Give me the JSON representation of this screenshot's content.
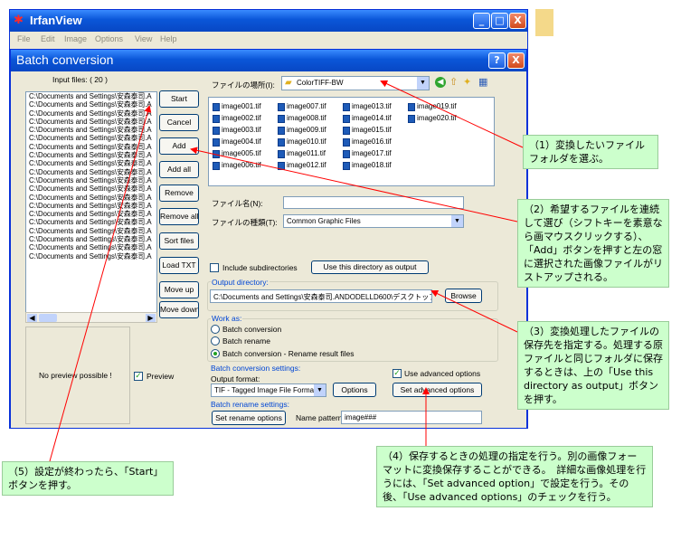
{
  "app": {
    "title": "IrfanView",
    "menu": [
      "File",
      "Edit",
      "Image",
      "Options",
      "View",
      "Help"
    ],
    "window_buttons": {
      "minimize": "_",
      "maximize": "□",
      "close": "X"
    }
  },
  "dialog": {
    "title": "Batch conversion",
    "help_button": "?",
    "close_button": "X",
    "input_files_label": "Input files:  ( 20 )",
    "input_files": [
      "C:\\Documents and Settings\\安森泰司.A",
      "C:\\Documents and Settings\\安森泰司.A",
      "C:\\Documents and Settings\\安森泰司.A",
      "C:\\Documents and Settings\\安森泰司.A",
      "C:\\Documents and Settings\\安森泰司.A",
      "C:\\Documents and Settings\\安森泰司.A",
      "C:\\Documents and Settings\\安森泰司.A",
      "C:\\Documents and Settings\\安森泰司.A",
      "C:\\Documents and Settings\\安森泰司.A",
      "C:\\Documents and Settings\\安森泰司.A",
      "C:\\Documents and Settings\\安森泰司.A",
      "C:\\Documents and Settings\\安森泰司.A",
      "C:\\Documents and Settings\\安森泰司.A",
      "C:\\Documents and Settings\\安森泰司.A",
      "C:\\Documents and Settings\\安森泰司.A",
      "C:\\Documents and Settings\\安森泰司.A",
      "C:\\Documents and Settings\\安森泰司.A",
      "C:\\Documents and Settings\\安森泰司.A",
      "C:\\Documents and Settings\\安森泰司.A",
      "C:\\Documents and Settings\\安森泰司.A"
    ],
    "buttons": {
      "start": "Start",
      "cancel": "Cancel",
      "add": "Add",
      "add_all": "Add all",
      "remove": "Remove",
      "remove_all": "Remove all",
      "sort_files": "Sort files",
      "load_txt": "Load TXT",
      "move_up": "Move up",
      "move_down": "Move down"
    },
    "preview_text": "No preview possible !",
    "preview_checkbox": "Preview",
    "look_in_label": "ファイルの場所(I):",
    "look_in_value": "ColorTIFF-BW",
    "files": [
      "image001.tif",
      "image002.tif",
      "image003.tif",
      "image004.tif",
      "image005.tif",
      "image006.tif",
      "image007.tif",
      "image008.tif",
      "image009.tif",
      "image010.tif",
      "image011.tif",
      "image012.tif",
      "image013.tif",
      "image014.tif",
      "image015.tif",
      "image016.tif",
      "image017.tif",
      "image018.tif",
      "image019.tif",
      "image020.tif"
    ],
    "filename_label": "ファイル名(N):",
    "filename_value": "",
    "filetype_label": "ファイルの種類(T):",
    "filetype_value": "Common Graphic Files",
    "include_subdirs": "Include subdirectories",
    "use_dir_button": "Use this directory as output",
    "output_dir_label": "Output directory:",
    "output_dir_value": "C:\\Documents and Settings\\安森泰司.ANDODELLD600\\デスクトップ\\E",
    "browse_button": "Browse",
    "work_as_label": "Work as:",
    "work_as_options": [
      "Batch conversion",
      "Batch rename",
      "Batch conversion - Rename result files"
    ],
    "work_as_selected": 2,
    "conversion_settings_label": "Batch conversion settings:",
    "output_format_label": "Output format:",
    "use_advanced_label": "Use advanced options",
    "output_format_value": "TIF - Tagged Image File Forma",
    "options_button": "Options",
    "set_advanced_button": "Set advanced options",
    "rename_settings_label": "Batch rename settings:",
    "set_rename_button": "Set rename options",
    "name_pattern_label": "Name pattern:",
    "name_pattern_value": "image###"
  },
  "callouts": {
    "c1": "（1）変換したいファイルフォルダを選ぶ。",
    "c2": "（2）希望するファイルを連続して選び（シフトキーを素意なら画マウスクリックする）、「Add」ボタンを押すと左の窓に選択された画像ファイルがリストアップされる。",
    "c3": "（3）変換処理したファイルの保存先を指定する。処理する原ファイルと同じフォルダに保存するときは、上の「Use this directory as output」ボタンを押す。",
    "c4": "（4）保存するときの処理の指定を行う。別の画像フォーマットに変換保存することができる。　詳細な画像処理を行うには、「Set advanced option」で設定を行う。その後、「Use advanced options」のチェックを行う。",
    "c5": "（5）設定が終わったら、「Start」ボタンを押す。"
  },
  "colors": {
    "titlebar": "#0a56d8",
    "window_bg": "#ece9d8",
    "callout_bg": "#ccffcc",
    "arrow": "#ff0000",
    "group_label": "#0046d5"
  }
}
